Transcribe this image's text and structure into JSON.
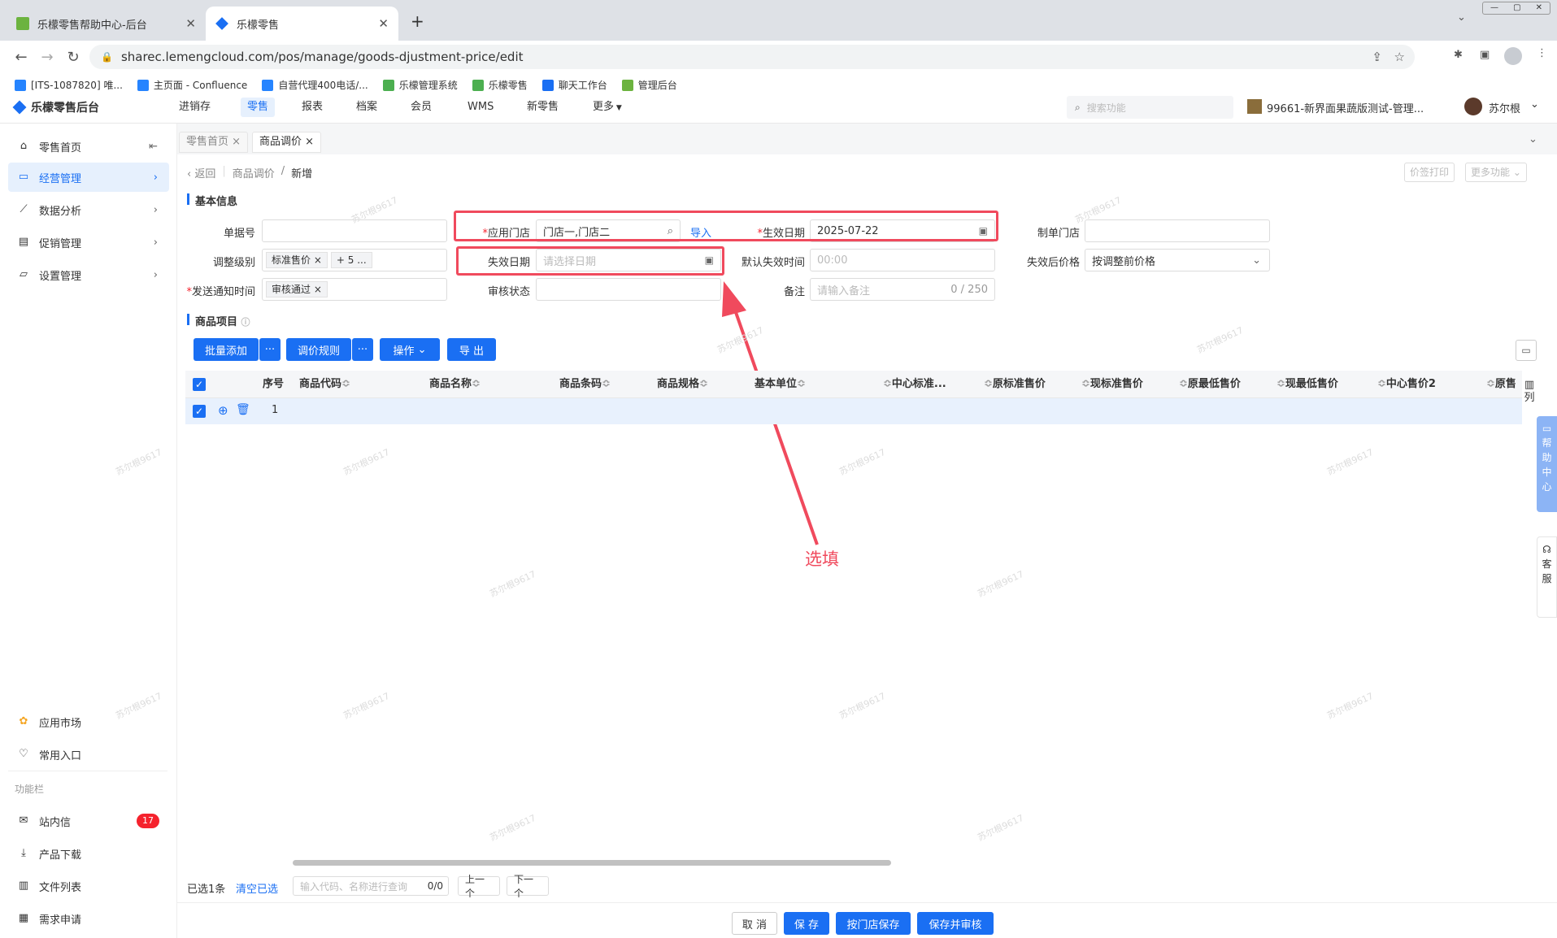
{
  "browser": {
    "tabs": [
      {
        "title": "乐檬零售帮助中心-后台",
        "active": false
      },
      {
        "title": "乐檬零售",
        "active": true
      }
    ],
    "new_tab": "+",
    "url": "sharec.lemengcloud.com/pos/manage/goods-djustment-price/edit",
    "bookmarks": [
      "[ITS-1087820] 唯...",
      "主页面 - Confluence",
      "自营代理400电话/...",
      "乐檬管理系统",
      "乐檬零售",
      "聊天工作台",
      "管理后台"
    ]
  },
  "app": {
    "brand": "乐檬零售后台",
    "nav": [
      "进销存",
      "零售",
      "报表",
      "档案",
      "会员",
      "WMS",
      "新零售",
      "更多"
    ],
    "active_nav": "零售",
    "search_placeholder": "搜索功能",
    "store": "99661-新界面果蔬版测试-管理...",
    "user": "苏尔根"
  },
  "sidebar": {
    "items": [
      {
        "label": "零售首页",
        "icon": "home-icon"
      },
      {
        "label": "经营管理",
        "icon": "chart-board-icon"
      },
      {
        "label": "数据分析",
        "icon": "line-chart-icon"
      },
      {
        "label": "促销管理",
        "icon": "promo-icon"
      },
      {
        "label": "设置管理",
        "icon": "folder-icon"
      }
    ],
    "bottom": [
      {
        "label": "应用市场",
        "icon": "app-market-icon"
      },
      {
        "label": "常用入口",
        "icon": "heart-icon"
      }
    ],
    "section_title": "功能栏",
    "func": [
      {
        "label": "站内信",
        "badge": "17"
      },
      {
        "label": "产品下载"
      },
      {
        "label": "文件列表"
      },
      {
        "label": "需求申请"
      }
    ]
  },
  "page_tabs": [
    {
      "label": "零售首页",
      "active": false
    },
    {
      "label": "商品调价",
      "active": true
    }
  ],
  "breadcrumb": {
    "back": "返回",
    "parent": "商品调价",
    "sep": "/",
    "current": "新增"
  },
  "top_actions": {
    "print": "价签打印",
    "more": "更多功能"
  },
  "basic": {
    "title": "基本信息",
    "doc_no_label": "单据号",
    "store_label": "应用门店",
    "store_value": "门店一,门店二",
    "import": "导入",
    "eff_date_label": "生效日期",
    "eff_date_value": "2025-07-22",
    "maker_store_label": "制单门店",
    "level_label": "调整级别",
    "level_tag": "标准售价",
    "level_more": "+ 5 ...",
    "expire_label": "失效日期",
    "expire_placeholder": "请选择日期",
    "default_time_label": "默认失效时间",
    "default_time_value": "00:00",
    "after_price_label": "失效后价格",
    "after_price_value": "按调整前价格",
    "notify_label": "发送通知时间",
    "notify_tag": "审核通过",
    "audit_label": "审核状态",
    "remark_label": "备注",
    "remark_placeholder": "请输入备注",
    "remark_count": "0 / 250"
  },
  "items": {
    "title": "商品项目",
    "buttons": [
      "批量添加",
      "调价规则",
      "操作",
      "导 出"
    ],
    "more": "···",
    "columns": [
      "序号",
      "商品代码",
      "商品名称",
      "商品条码",
      "商品规格",
      "基本单位",
      "中心标准...",
      "原标准售价",
      "现标准售价",
      "原最低售价",
      "现最低售价",
      "中心售价2",
      "原售"
    ],
    "row_no": "1",
    "col_side": "列"
  },
  "annotation": {
    "text": "选填",
    "color": "#f04a5d"
  },
  "bottom": {
    "selected": "已选1条",
    "clear": "清空已选",
    "query_placeholder": "输入代码、名称进行查询",
    "query_count": "0/0",
    "prev": "上一个",
    "next": "下一个",
    "actions": [
      "取 消",
      "保 存",
      "按门店保存",
      "保存并审核"
    ]
  },
  "side_float": {
    "help": "帮助中心",
    "service": "客服"
  },
  "watermark": "苏尔根9617"
}
